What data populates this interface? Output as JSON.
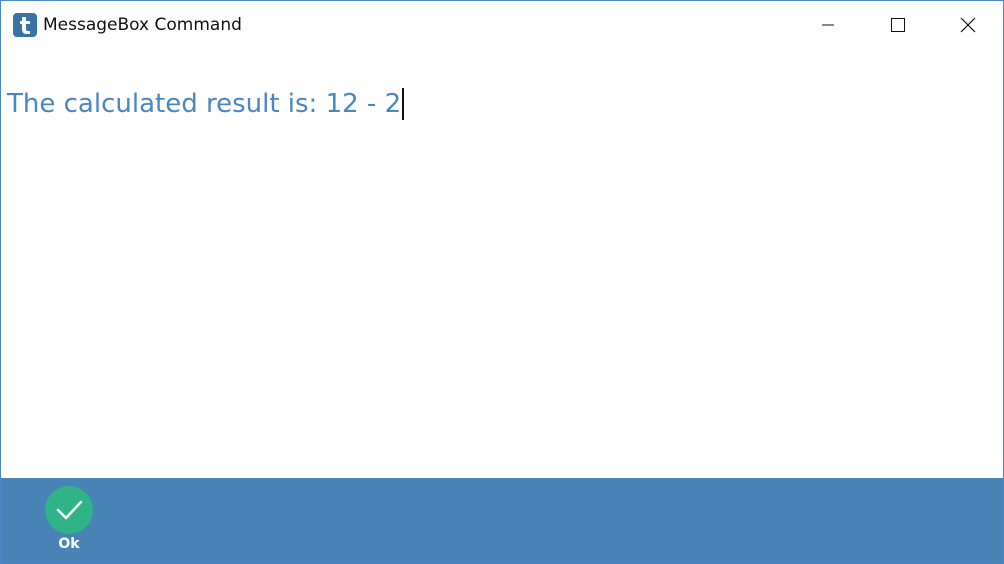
{
  "window": {
    "title": "MessageBox Command",
    "icon": "app-t-icon",
    "controls": [
      "minimize-icon",
      "maximize-icon",
      "close-icon"
    ]
  },
  "message": {
    "text": "The calculated result is: 12 - 2"
  },
  "toolbar": {
    "ok_label": "Ok",
    "ok_icon": "check-icon"
  },
  "colors": {
    "message_text": "#4a86c0",
    "toolbar_bg": "#4883b6",
    "ok_circle": "#2fb387",
    "app_icon_bg": "#3a72a6"
  }
}
